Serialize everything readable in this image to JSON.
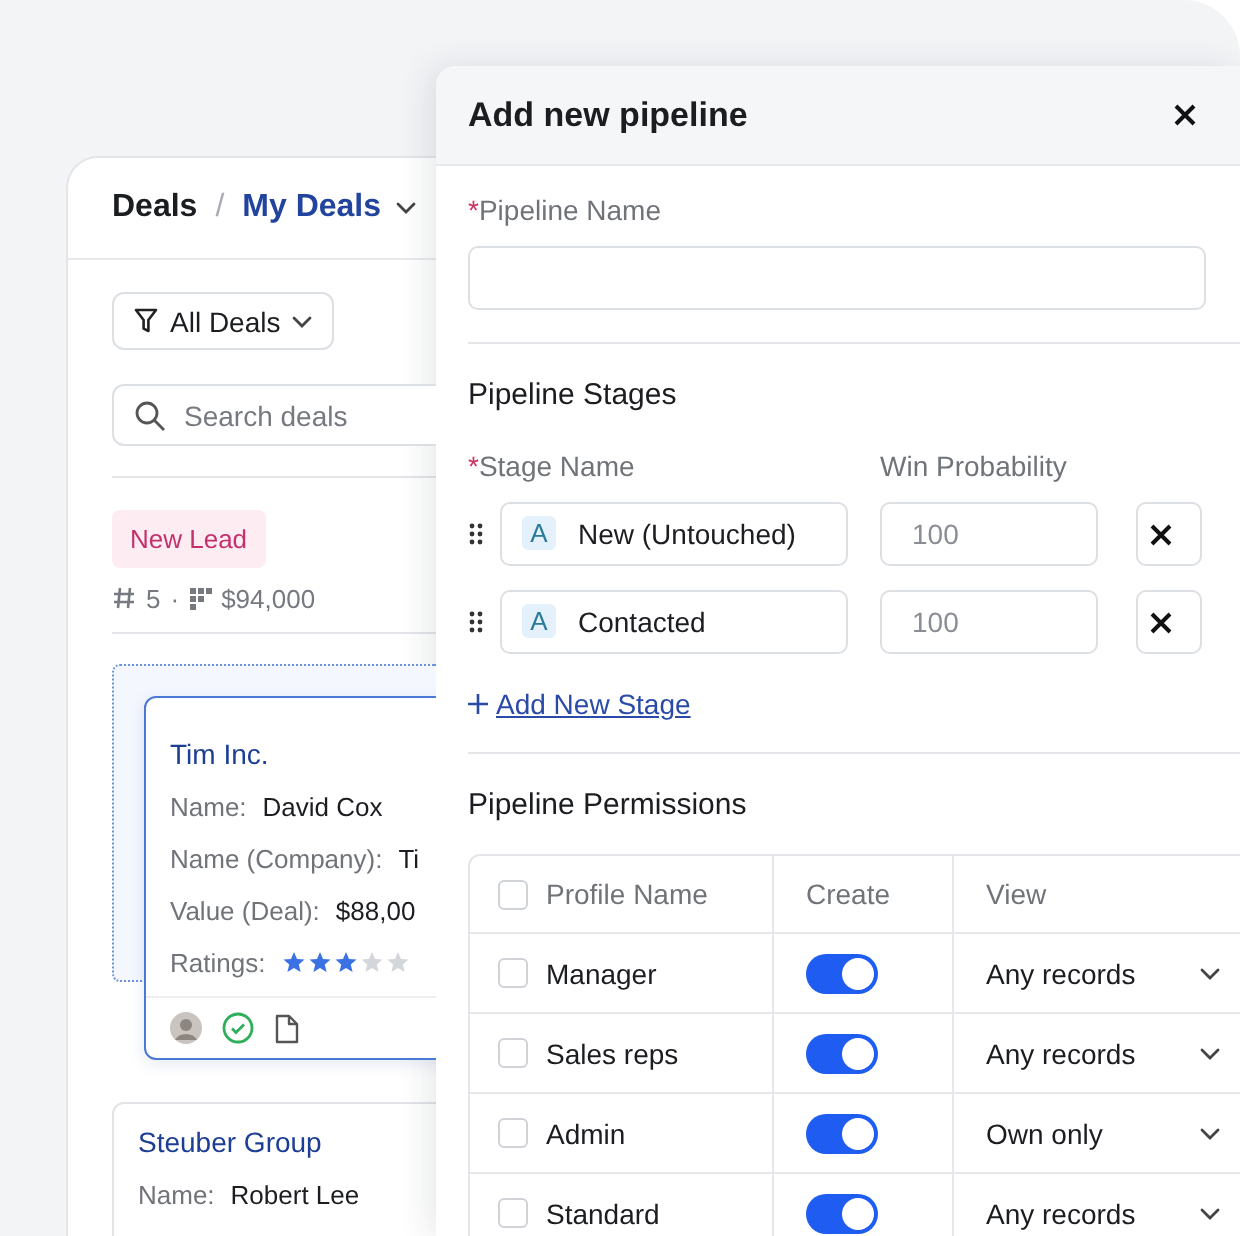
{
  "deals_panel": {
    "title": "Deals",
    "separator": "/",
    "view": "My Deals",
    "filter": "All Deals",
    "search": {
      "placeholder": "Search deals"
    },
    "stage": {
      "label": "New Lead",
      "count": "5",
      "dot": "·",
      "amount": "$94,000"
    },
    "cards": [
      {
        "title": "Tim Inc.",
        "dragging": true,
        "fields": [
          {
            "label": "Name:",
            "value": "David Cox"
          },
          {
            "label": "Name (Company):",
            "value": "Ti"
          },
          {
            "label": "Value (Deal):",
            "value": "$88,00"
          }
        ],
        "ratings": {
          "label": "Ratings:",
          "stars": 3
        }
      },
      {
        "title": "Steuber Group",
        "dragging": false,
        "fields": [
          {
            "label": "Name:",
            "value": "Robert Lee"
          }
        ]
      }
    ]
  },
  "modal": {
    "title": "Add new pipeline",
    "name_field": {
      "required_mark": "*",
      "label": "Pipeline Name"
    },
    "stages_section": {
      "title": "Pipeline Stages",
      "required_mark": "*",
      "name_label": "Stage Name",
      "probability_label": "Win Probability",
      "stages": [
        {
          "badge": "A",
          "name": "New (Untouched)",
          "probability_placeholder": "100"
        },
        {
          "badge": "A",
          "name": "Contacted",
          "probability_placeholder": "100"
        }
      ],
      "add_link": "Add New Stage"
    },
    "permissions": {
      "title": "Pipeline Permissions",
      "columns": [
        "Profile Name",
        "Create",
        "View"
      ],
      "header_checked": false,
      "rows": [
        {
          "profile": "Manager",
          "checked": false,
          "create": true,
          "view": "Any records"
        },
        {
          "profile": "Sales reps",
          "checked": false,
          "create": true,
          "view": "Any records"
        },
        {
          "profile": "Admin",
          "checked": false,
          "create": true,
          "view": "Own only"
        },
        {
          "profile": "Standard",
          "checked": false,
          "create": true,
          "view": "Any records"
        }
      ]
    }
  }
}
